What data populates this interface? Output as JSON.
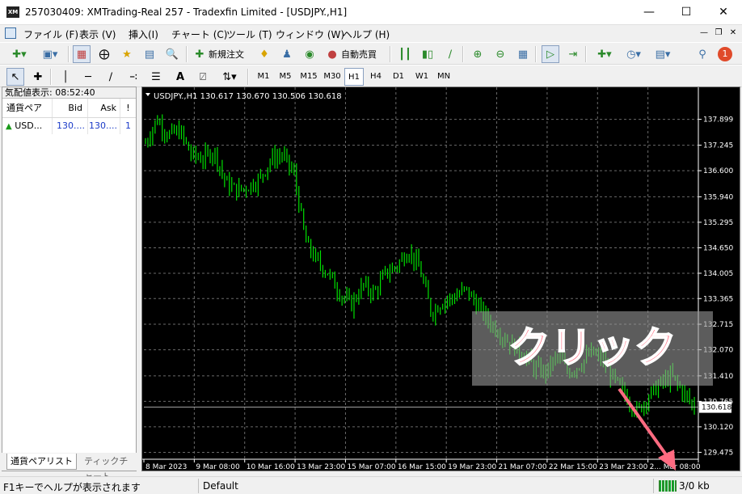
{
  "window": {
    "title": "257030409: XMTrading-Real 257 - Tradexfin Limited - [USDJPY.,H1]",
    "icon_text": "XM",
    "controls": [
      "minimize-icon",
      "maximize-icon",
      "close-icon"
    ]
  },
  "menu": {
    "items": [
      "ファイル (F)",
      "表示 (V)",
      "挿入(I)",
      "チャート (C)",
      "ツール (T)",
      "ウィンドウ (W)",
      "ヘルプ (H)"
    ]
  },
  "toolbar": {
    "new_order": "新規注文",
    "auto_trade": "自動売買",
    "timeframes": [
      "M1",
      "M5",
      "M15",
      "M30",
      "H1",
      "H4",
      "D1",
      "W1",
      "MN"
    ],
    "active_timeframe": "H1",
    "notification_count": "1"
  },
  "market_watch": {
    "title": "気配値表示: 08:52:40",
    "columns": [
      "通貨ペア",
      "Bid",
      "Ask",
      "!"
    ],
    "rows": [
      {
        "symbol": "USD...",
        "bid": "130....",
        "ask": "130....",
        "spread": "1"
      }
    ],
    "tabs": [
      "通貨ペアリスト",
      "ティックチャート"
    ]
  },
  "chart": {
    "header": "USDJPY.,H1  130.617 130.670 130.506 130.618",
    "current_price": "130.618",
    "overlay_text": "クリック",
    "colors": {
      "background": "#000000",
      "candles": "#00e000",
      "grid": "#6a6a6a",
      "price_line": "#ffffff",
      "arrow": "#ff6b81"
    }
  },
  "chart_data": {
    "type": "bar",
    "symbol": "USDJPY.",
    "timeframe": "H1",
    "y_ticks": [
      "137.899",
      "137.245",
      "136.600",
      "135.940",
      "135.295",
      "134.650",
      "134.005",
      "133.365",
      "132.715",
      "132.070",
      "131.410",
      "130.765",
      "130.120",
      "129.475"
    ],
    "x_ticks": [
      "8 Mar 2023",
      "9 Mar 08:00",
      "10 Mar 16:00",
      "13 Mar 23:00",
      "15 Mar 07:00",
      "16 Mar 15:00",
      "19 Mar 23:00",
      "21 Mar 07:00",
      "22 Mar 15:00",
      "23 Mar 23:00",
      "2... Mar 08:00"
    ],
    "ylim": [
      129.3,
      138.3
    ],
    "series": [
      {
        "values": [
          137.3,
          137.9,
          137.5,
          137.6,
          137.0,
          136.9,
          137.1,
          136.3,
          136.1,
          136.2,
          136.4,
          136.9,
          137.0,
          136.5,
          134.8,
          134.3,
          134.0,
          133.5,
          133.2,
          133.7,
          133.5,
          134.0,
          134.2,
          134.6,
          134.1,
          133.0,
          133.3,
          133.4,
          133.6,
          133.2,
          132.8,
          132.5,
          132.2,
          132.0,
          131.6,
          131.5,
          131.9,
          131.5,
          131.7,
          132.0,
          131.8,
          131.3,
          130.9,
          130.5,
          130.9,
          131.2,
          131.4,
          131.0,
          130.618
        ]
      }
    ]
  },
  "status": {
    "help": "F1キーでヘルプが表示されます",
    "profile": "Default",
    "traffic": "3/0 kb"
  }
}
